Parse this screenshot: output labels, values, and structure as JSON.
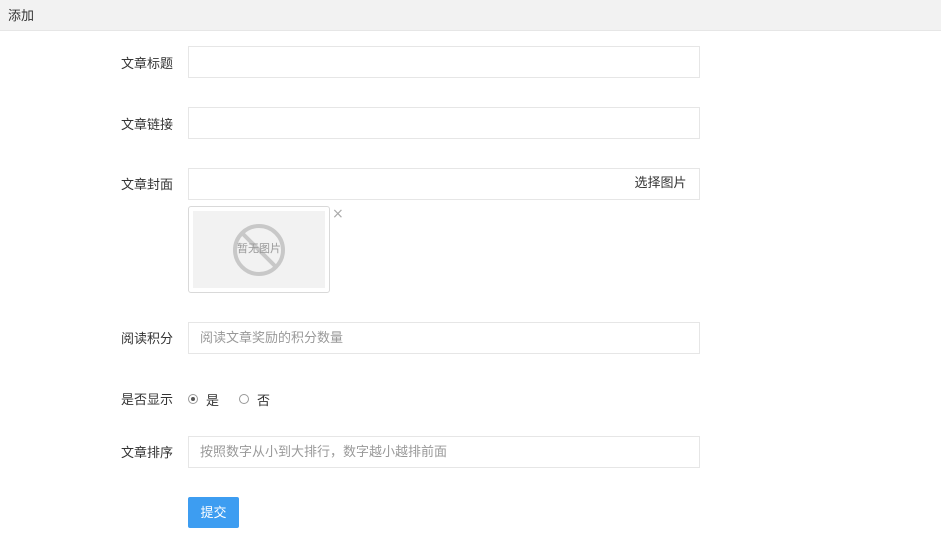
{
  "header": {
    "title": "添加"
  },
  "form": {
    "title_label": "文章标题",
    "title_value": "",
    "link_label": "文章链接",
    "link_value": "",
    "cover_label": "文章封面",
    "cover_value": "",
    "choose_image_label": "选择图片",
    "no_image_text": "暂无图片",
    "remove_icon": "×",
    "points_label": "阅读积分",
    "points_placeholder": "阅读文章奖励的积分数量",
    "display_label": "是否显示",
    "display_options": [
      {
        "label": "是",
        "checked": true
      },
      {
        "label": "否",
        "checked": false
      }
    ],
    "sort_label": "文章排序",
    "sort_placeholder": "按照数字从小到大排行，数字越小越排前面",
    "submit_label": "提交"
  },
  "colors": {
    "submit_bg": "#3d9df1",
    "header_bg": "#f2f2f2",
    "input_border": "#e6e6e6"
  }
}
